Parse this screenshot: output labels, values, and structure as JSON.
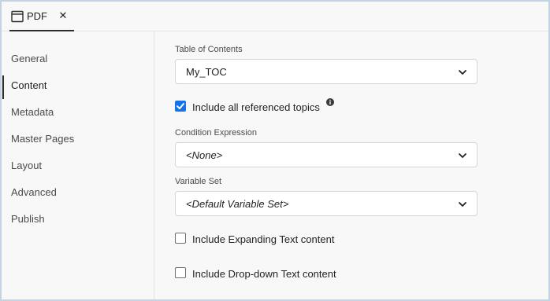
{
  "tab": {
    "label": "PDF",
    "close_glyph": "✕"
  },
  "sidebar": {
    "items": [
      {
        "label": "General",
        "active": false
      },
      {
        "label": "Content",
        "active": true
      },
      {
        "label": "Metadata",
        "active": false
      },
      {
        "label": "Master Pages",
        "active": false
      },
      {
        "label": "Layout",
        "active": false
      },
      {
        "label": "Advanced",
        "active": false
      },
      {
        "label": "Publish",
        "active": false
      }
    ]
  },
  "form": {
    "toc": {
      "label": "Table of Contents",
      "value": "My_TOC"
    },
    "include_topics": {
      "label": "Include all referenced topics",
      "checked": true
    },
    "condition": {
      "label": "Condition Expression",
      "value": "<None>"
    },
    "variable_set": {
      "label": "Variable Set",
      "value": "<Default Variable Set>"
    },
    "expanding_text": {
      "label": "Include Expanding Text content",
      "checked": false
    },
    "dropdown_text": {
      "label": "Include Drop-down Text content",
      "checked": false
    }
  },
  "colors": {
    "accent": "#1473e6",
    "frame": "#c3d3e6",
    "background": "#f8f8f8"
  },
  "icons": {
    "tab": "window-icon",
    "info": "info-icon",
    "chevron": "chevron-down-icon",
    "check": "checkmark-icon"
  }
}
